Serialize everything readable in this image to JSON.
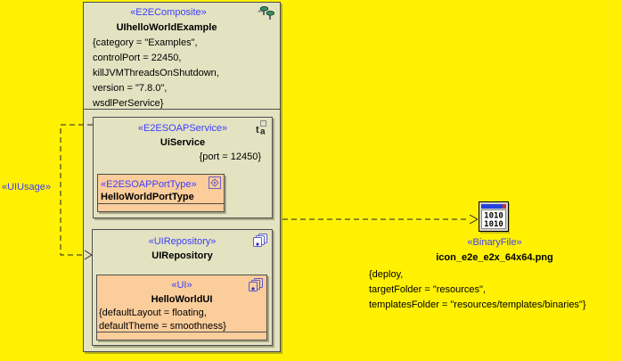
{
  "composite": {
    "stereotype": "«E2EComposite»",
    "name": "UIhelloWorldExample",
    "properties": [
      "{category = \"Examples\",",
      "controlPort = 22450,",
      "killJVMThreadsOnShutdown,",
      "version = \"7.8.0\",",
      "wsdlPerService}"
    ]
  },
  "service": {
    "stereotype": "«E2ESOAPService»",
    "name": "UiService",
    "tagged_value": "{port = 12450}",
    "porttype": {
      "stereotype": "«E2ESOAPPortType»",
      "name": "HelloWorldPortType"
    }
  },
  "repository": {
    "stereotype": "«UIRepository»",
    "name": "UIRepository",
    "ui": {
      "stereotype": "«UI»",
      "name": "HelloWorldUI",
      "properties": [
        "{defaultLayout = floating,",
        "defaultTheme = smoothness}"
      ]
    }
  },
  "usage": {
    "label": "«UIUsage»"
  },
  "binary_file": {
    "stereotype": "«BinaryFile»",
    "name": "icon_e2e_e2x_64x64.png",
    "properties": [
      "{deploy,",
      "targetFolder = \"resources\",",
      "templatesFolder = \"resources/templates/binaries\"}"
    ],
    "icon_pattern_row1": "1010",
    "icon_pattern_row2": "1010"
  },
  "icons": {
    "composite-icon": "two-green-component-figures",
    "part-icon": "part-square-with-a",
    "porttype-icon": "orange-square-diamond",
    "copies-icon": "stacked-documents",
    "binary-file-icon": "window-with-binary-digits"
  },
  "colors": {
    "background": "#FFF101",
    "node_fill": "#E3E3C2",
    "highlight_fill": "#FACD9B",
    "stereotype_text": "#3C3CFF",
    "icon_border": "#6C5FC7",
    "node_border": "#4D4D4D"
  }
}
